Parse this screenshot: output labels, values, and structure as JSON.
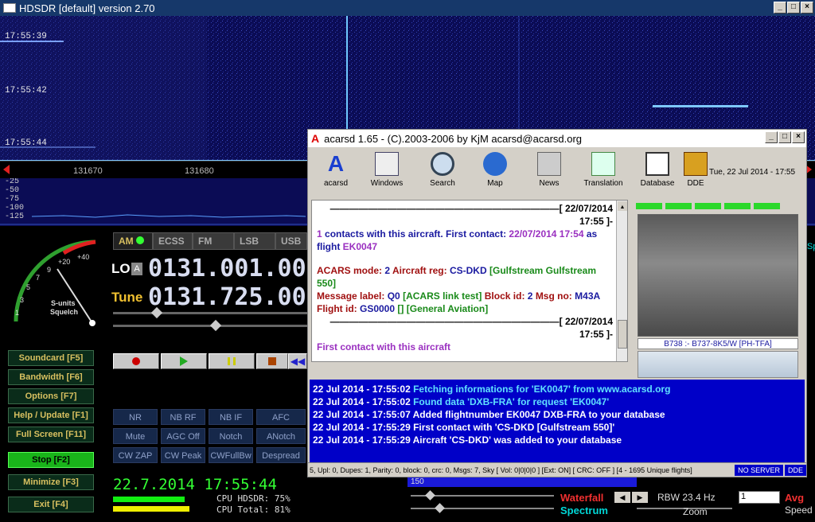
{
  "hdsdr": {
    "title": "HDSDR [default]  version 2.70",
    "timestamps": [
      "17:55:39",
      "17:55:42",
      "17:55:44"
    ],
    "freq_ticks": [
      "131670",
      "131680"
    ],
    "db_scale": [
      "-25",
      "-50",
      "-75",
      "-100",
      "-125"
    ],
    "modes": [
      "AM",
      "ECSS",
      "FM",
      "LSB",
      "USB"
    ],
    "lo_label": "LO",
    "lo_a": "A",
    "lo_freq": "0131.001.00",
    "tune_label": "Tune",
    "tune_freq": "0131.725.00",
    "smeter_labels": [
      "1",
      "3",
      "5",
      "7",
      "9",
      "+20",
      "+40"
    ],
    "smeter_caption_1": "S-units",
    "smeter_caption_2": "Squelch",
    "side_buttons": [
      "Soundcard  [F5]",
      "Bandwidth  [F6]",
      "Options  [F7]",
      "Help / Update  [F1]",
      "Full Screen  [F11]",
      "Stop  [F2]",
      "Minimize  [F3]",
      "Exit  [F4]"
    ],
    "dsp_buttons": [
      "NR",
      "NB RF",
      "NB IF",
      "AFC",
      "Mute",
      "AGC Off",
      "Notch",
      "ANotch",
      "CW ZAP",
      "CW Peak",
      "CWFullBw",
      "Despread"
    ],
    "datetime": "22.7.2014 17:55:44",
    "cpu_hdsdr": "CPU HDSDR: 75%",
    "cpu_total": "CPU Total: 81%",
    "waterfall_label": "Waterfall",
    "spectrum_label": "Spectrum",
    "rbw": "RBW 23.4 Hz",
    "avg_value": "1",
    "avg_label": "Avg",
    "zoom_label": "Zoom",
    "speed_label": "Speed",
    "scale_150": "150",
    "spe_fragment": "Spe"
  },
  "acarsd": {
    "title": "acarsd 1.65 - (C).2003-2006 by KjM acarsd@acarsd.org",
    "toolbar": [
      "acarsd",
      "Windows",
      "Search",
      "Map",
      "News",
      "Translation",
      "Database",
      "DDE"
    ],
    "date": "Tue, 22 Jul 2014 - 17:55",
    "msg_header_1": "[ 22/07/2014 17:55 ]-",
    "msg_count": "1",
    "msg_contact_text": " contacts with this aircraft. First contact: ",
    "msg_first_date": "22/07/2014 17:54",
    "msg_as_flight": " as flight ",
    "msg_flight": "EK0047",
    "acars_mode_label": "ACARS mode:",
    "acars_mode": "2",
    "aircraft_reg_label": "Aircraft reg:",
    "aircraft_reg": "CS-DKD",
    "aircraft_type": "[Gulfstream Gulfstream 550]",
    "msg_label_label": "Message label:",
    "msg_label": "Q0",
    "msg_label_desc": "[ACARS link test]",
    "block_id_label": "Block id:",
    "block_id": "2",
    "msg_no_label": "Msg no:",
    "msg_no": "M43A",
    "flight_id_label": "Flight id:",
    "flight_id": "GS0000",
    "flight_bracket": "[]",
    "flight_desc": "[General Aviation]",
    "msg_header_2": "[ 22/07/2014 17:55 ]-",
    "first_contact": "First contact with this aircraft",
    "photo_caption": "B738 :- B737-8K5/W [PH-TFA]",
    "log": [
      {
        "prefix": "22 Jul 2014 - 17:55:02 ",
        "text": "Fetching informations for 'EK0047' from www.acarsd.org",
        "hl": ""
      },
      {
        "prefix": "22 Jul 2014 - 17:55:02 ",
        "text": "Found data 'DXB-FRA' for request 'EK0047'",
        "hl": ""
      },
      {
        "prefix": "22 Jul 2014 - 17:55:07 ",
        "text": "Added flightnumber EK0047 DXB-FRA to your database",
        "hl": ""
      },
      {
        "prefix": "22 Jul 2014 - 17:55:29 ",
        "text": "First contact with 'CS-DKD [Gulfstream 550]'",
        "hl": ""
      },
      {
        "prefix": "22 Jul 2014 - 17:55:29 ",
        "text": "Aircraft 'CS-DKD' was added to your database",
        "hl": ""
      }
    ],
    "status_main": "5, Upl: 0, Dupes: 1, Parity: 0, block: 0, crc: 0, Msgs: 7, Sky [ Vol: 0|0|0|0 ]  [Ext: ON]  [ CRC: OFF ]  [4 - 1695 Unique flights]",
    "status_server": "NO SERVER",
    "status_dde": "DDE"
  },
  "colors": {
    "waterfall_bg": "#0b0c55",
    "log_bg": "#0000c8",
    "green_active": "#19b41a",
    "freq_text": "#d8ddf0"
  }
}
